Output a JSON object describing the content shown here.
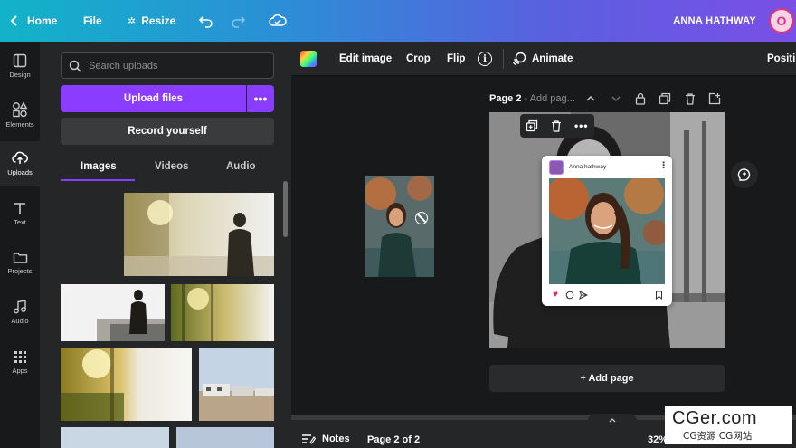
{
  "topbar": {
    "home": "Home",
    "file": "File",
    "resize": "Resize",
    "user_name": "ANNA HATHWAY",
    "avatar_initial": "O"
  },
  "rail": {
    "items": [
      {
        "label": "Design",
        "icon": "design-icon"
      },
      {
        "label": "Elements",
        "icon": "elements-icon"
      },
      {
        "label": "Uploads",
        "icon": "cloud-upload-icon",
        "active": true
      },
      {
        "label": "Text",
        "icon": "text-icon"
      },
      {
        "label": "Projects",
        "icon": "folder-icon"
      },
      {
        "label": "Audio",
        "icon": "music-note-icon"
      },
      {
        "label": "Apps",
        "icon": "apps-grid-icon"
      }
    ]
  },
  "panel": {
    "search_placeholder": "Search uploads",
    "upload_label": "Upload files",
    "more_label": "•••",
    "record_label": "Record yourself",
    "tabs": [
      "Images",
      "Videos",
      "Audio"
    ]
  },
  "toolbar": {
    "edit_image": "Edit image",
    "crop": "Crop",
    "flip": "Flip",
    "info": "i",
    "animate": "Animate",
    "position": "Positi"
  },
  "page": {
    "title": "Page 2",
    "subtitle": "Add pag...",
    "add_page": "+ Add page"
  },
  "post": {
    "username": "Anna hathway"
  },
  "bottombar": {
    "notes": "Notes",
    "page_indicator": "Page 2 of 2",
    "zoom": "32%"
  },
  "watermark": {
    "text": "CGer.com",
    "sub": "CG资源 CG网站"
  },
  "colors": {
    "accent": "#8b3dff",
    "heart": "#e0245e"
  }
}
